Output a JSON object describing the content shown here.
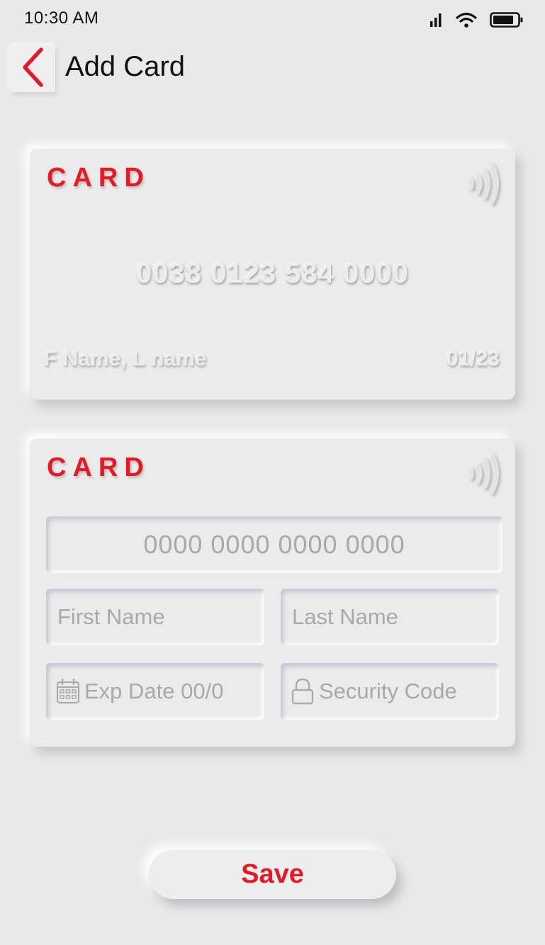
{
  "status_bar": {
    "time": "10:30 AM",
    "icons": [
      "signal-icon",
      "wifi-icon",
      "battery-icon"
    ]
  },
  "header": {
    "title": "Add Card",
    "back_icon": "chevron-left-icon"
  },
  "card_preview": {
    "brand": "CARD",
    "number": "0038 0123 584 0000",
    "holder_name": "F Name, L name",
    "expiry": "01/23",
    "icon": "contactless-icon"
  },
  "card_form": {
    "brand": "CARD",
    "icon": "contactless-icon",
    "card_number_placeholder": "0000 0000 0000 0000",
    "first_name_placeholder": "First Name",
    "last_name_placeholder": "Last Name",
    "exp_date_placeholder": "Exp Date 00/0",
    "security_code_placeholder": "Security Code",
    "exp_icon": "calendar-icon",
    "security_icon": "lock-icon"
  },
  "actions": {
    "save_label": "Save"
  },
  "colors": {
    "accent": "#e21b26",
    "background": "#e9e9e9",
    "placeholder": "#a9a9a9"
  }
}
